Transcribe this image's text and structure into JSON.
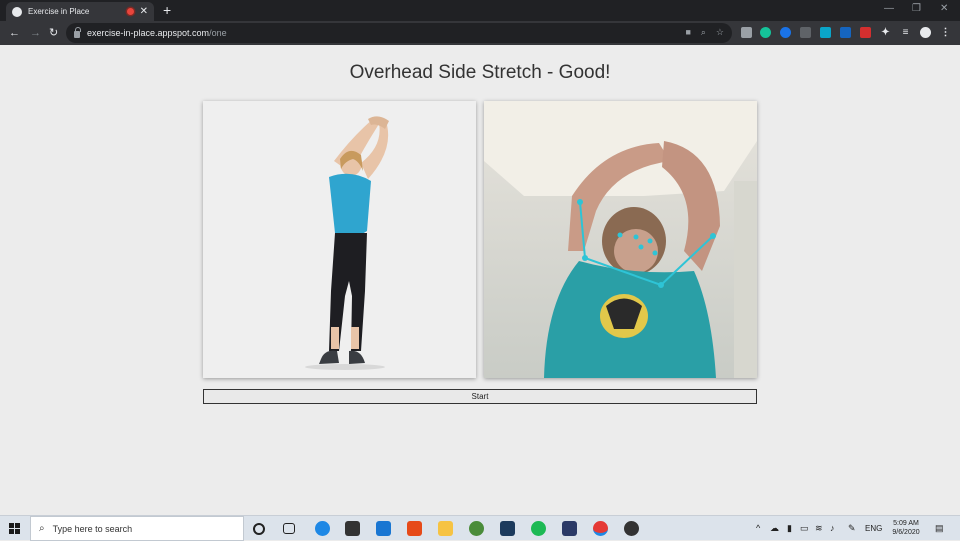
{
  "browser": {
    "tab_title": "Exercise in Place",
    "url_host": "exercise-in-place.appspot.com",
    "url_path": "/one"
  },
  "page": {
    "title": "Overhead Side Stretch - Good!",
    "start_label": "Start"
  },
  "taskbar": {
    "search_placeholder": "Type here to search",
    "language": "ENG",
    "time": "5:09 AM",
    "date": "9/6/2020"
  },
  "pose_overlay": {
    "color": "#2ec4d6"
  },
  "extension_icons": [
    "camera-icon",
    "zoom-icon",
    "bookmark-star-icon",
    "ext-icon",
    "grammarly-icon",
    "ext-icon",
    "ext-icon",
    "ext-icon",
    "ext-icon",
    "ext-icon",
    "puzzle-icon",
    "media-icon",
    "profile-icon",
    "menu-icon"
  ]
}
